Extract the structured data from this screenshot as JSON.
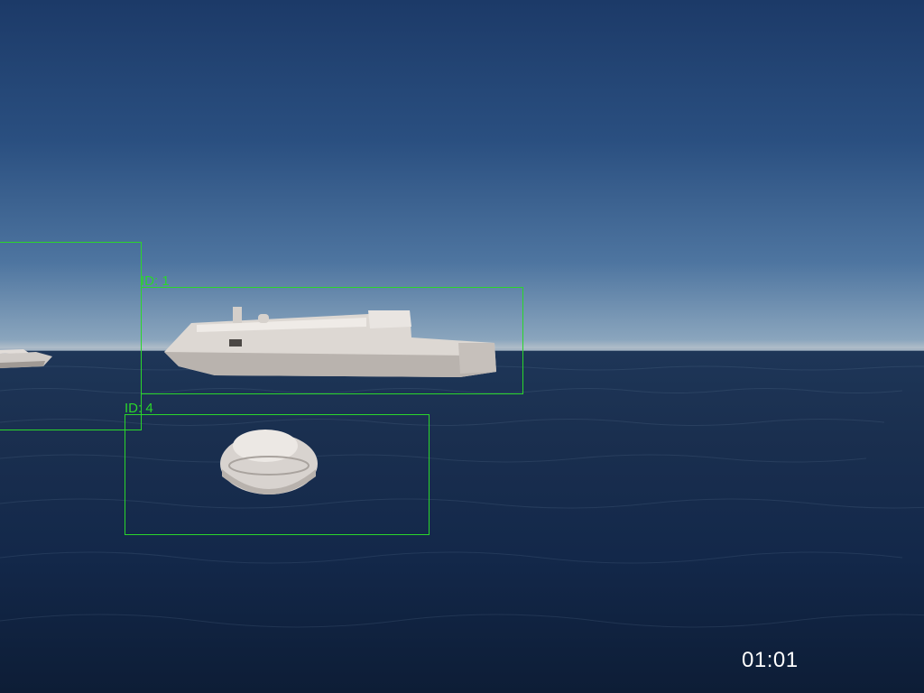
{
  "scene": {
    "sky_top_color": "#1c3a68",
    "sea_color": "#13284a",
    "box_color": "#2bd62b"
  },
  "detections": [
    {
      "id_label": "ID: 1",
      "object": "ship"
    },
    {
      "id_label": "ID: 4",
      "object": "boat"
    },
    {
      "id_label": "",
      "object": "ship"
    }
  ],
  "overlay": {
    "timestamp": "01:01"
  }
}
